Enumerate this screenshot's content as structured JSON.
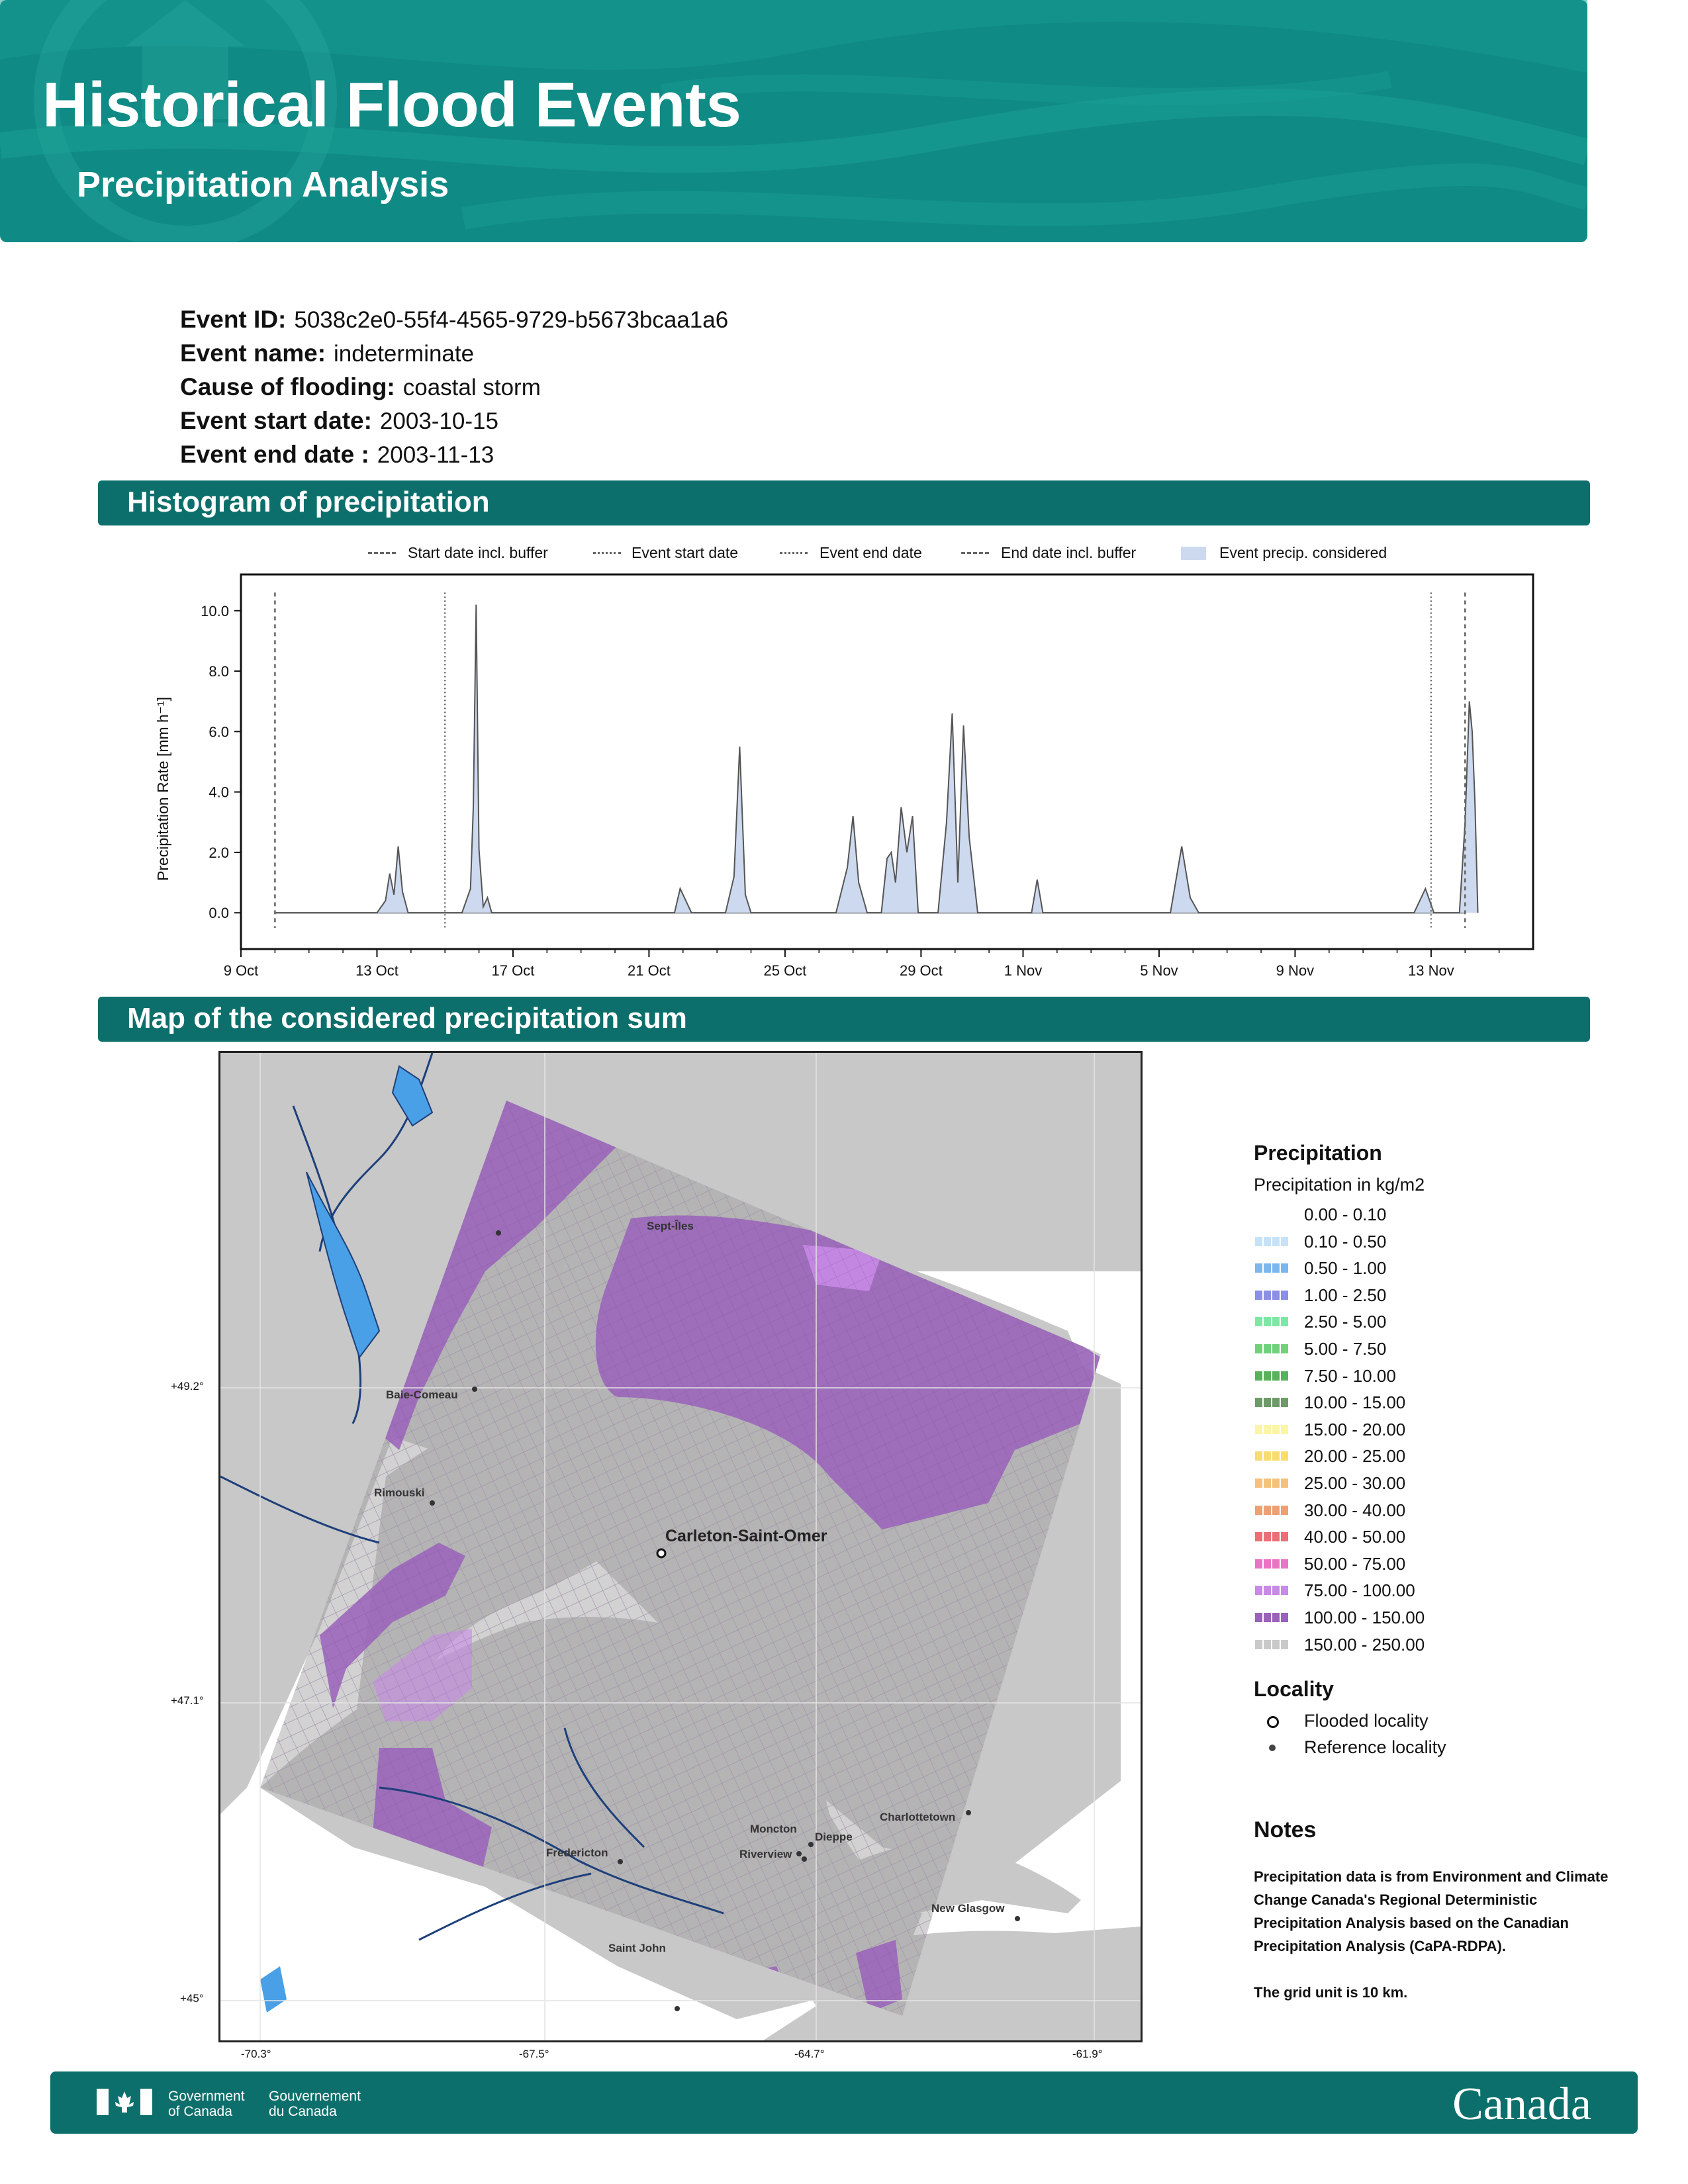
{
  "header": {
    "title": "Historical Flood Events",
    "subtitle": "Precipitation Analysis",
    "background_color": "#108a84"
  },
  "event": {
    "id_label": "Event ID:",
    "id": "5038c2e0-55f4-4565-9729-b5673bcaa1a6",
    "name_label": "Event name:",
    "name": "indeterminate",
    "cause_label": "Cause of flooding:",
    "cause": "coastal storm",
    "start_label": "Event start date:",
    "start": "2003-10-15",
    "end_label": "Event end date :",
    "end": "2003-11-13"
  },
  "sections": {
    "histogram": "Histogram of precipitation",
    "map": "Map of the considered precipitation sum",
    "color": "#0d6f6b"
  },
  "chart_data": {
    "type": "area",
    "title": "",
    "xlabel": "",
    "ylabel": "Precipitation Rate [mm h⁻¹]",
    "x_ticks": [
      "9 Oct",
      "13 Oct",
      "17 Oct",
      "21 Oct",
      "25 Oct",
      "29 Oct",
      "1 Nov",
      "5 Nov",
      "9 Nov",
      "13 Nov"
    ],
    "y_ticks": [
      "0.0",
      "2.0",
      "4.0",
      "6.0",
      "8.0",
      "10.0"
    ],
    "ylim": [
      -1.2,
      11.2
    ],
    "xlim": [
      "2003-10-09",
      "2003-11-16"
    ],
    "legend_position": "top",
    "legend": [
      "Start date incl. buffer",
      "Event start date",
      "Event end date",
      "End date incl. buffer",
      "Event precip. considered"
    ],
    "markers": {
      "start_buffer": "2003-10-10",
      "event_start": "2003-10-15",
      "event_end": "2003-11-13",
      "end_buffer": "2003-11-14"
    },
    "series": [
      {
        "values": [
          [
            "2003-10-10",
            0
          ],
          [
            "2003-10-13",
            0
          ],
          [
            "2003-10-13 06:00",
            0.4
          ],
          [
            "2003-10-13 09:00",
            1.3
          ],
          [
            "2003-10-13 12:00",
            0.6
          ],
          [
            "2003-10-13 15:00",
            2.2
          ],
          [
            "2003-10-13 18:00",
            0.7
          ],
          [
            "2003-10-13 22:00",
            0
          ],
          [
            "2003-10-15 12:00",
            0
          ],
          [
            "2003-10-15 18:00",
            0.8
          ],
          [
            "2003-10-15 20:00",
            3.5
          ],
          [
            "2003-10-15 22:00",
            10.2
          ],
          [
            "2003-10-16 00:00",
            2.1
          ],
          [
            "2003-10-16 03:00",
            0.2
          ],
          [
            "2003-10-16 06:00",
            0.5
          ],
          [
            "2003-10-16 09:00",
            0
          ],
          [
            "2003-10-21 18:00",
            0
          ],
          [
            "2003-10-21 22:00",
            0.8
          ],
          [
            "2003-10-22 02:00",
            0.4
          ],
          [
            "2003-10-22 06:00",
            0
          ],
          [
            "2003-10-23 06:00",
            0
          ],
          [
            "2003-10-23 12:00",
            1.2
          ],
          [
            "2003-10-23 16:00",
            5.5
          ],
          [
            "2003-10-23 20:00",
            0.6
          ],
          [
            "2003-10-24 00:00",
            0
          ],
          [
            "2003-10-26 12:00",
            0
          ],
          [
            "2003-10-26 20:00",
            1.5
          ],
          [
            "2003-10-27 00:00",
            3.2
          ],
          [
            "2003-10-27 04:00",
            1.0
          ],
          [
            "2003-10-27 10:00",
            0
          ],
          [
            "2003-10-27 20:00",
            0
          ],
          [
            "2003-10-28 00:00",
            1.8
          ],
          [
            "2003-10-28 03:00",
            2.0
          ],
          [
            "2003-10-28 06:00",
            1.0
          ],
          [
            "2003-10-28 10:00",
            3.5
          ],
          [
            "2003-10-28 14:00",
            2.0
          ],
          [
            "2003-10-28 18:00",
            3.2
          ],
          [
            "2003-10-28 22:00",
            0
          ],
          [
            "2003-10-29 12:00",
            0
          ],
          [
            "2003-10-29 18:00",
            3.0
          ],
          [
            "2003-10-29 22:00",
            6.6
          ],
          [
            "2003-10-30 02:00",
            1.0
          ],
          [
            "2003-10-30 06:00",
            6.2
          ],
          [
            "2003-10-30 10:00",
            2.5
          ],
          [
            "2003-10-30 16:00",
            0
          ],
          [
            "2003-11-01 06:00",
            0
          ],
          [
            "2003-11-01 10:00",
            1.1
          ],
          [
            "2003-11-01 14:00",
            0
          ],
          [
            "2003-11-05 08:00",
            0
          ],
          [
            "2003-11-05 16:00",
            2.2
          ],
          [
            "2003-11-05 22:00",
            0.5
          ],
          [
            "2003-11-06 04:00",
            0
          ],
          [
            "2003-11-12 12:00",
            0
          ],
          [
            "2003-11-12 20:00",
            0.8
          ],
          [
            "2003-11-13 02:00",
            0
          ],
          [
            "2003-11-13 20:00",
            0
          ],
          [
            "2003-11-14 00:00",
            3.0
          ],
          [
            "2003-11-14 03:00",
            7.0
          ],
          [
            "2003-11-14 05:00",
            6.0
          ],
          [
            "2003-11-14 07:00",
            3.6
          ],
          [
            "2003-11-14 09:00",
            0
          ]
        ]
      }
    ]
  },
  "map": {
    "coords": {
      "lat1": "+49.2°",
      "lat2": "+47.1°",
      "lat3": "+45°",
      "lon1": "-70.3°",
      "lon2": "-67.5°",
      "lon3": "-64.7°",
      "lon4": "-61.9°"
    },
    "flooded_locality": "Carleton-Saint-Omer",
    "reference_localities": [
      "Sept-Îles",
      "Baie-Comeau",
      "Rimouski",
      "Moncton",
      "Dieppe",
      "Riverview",
      "Fredericton",
      "Charlottetown",
      "New Glasgow",
      "Saint John"
    ]
  },
  "map_legend": {
    "title": "Precipitation",
    "subtitle": "Precipitation in kg/m2",
    "classes": [
      {
        "label": "0.00 - 0.10",
        "color": "#ffffff"
      },
      {
        "label": "0.10 - 0.50",
        "color": "#c6e2f7"
      },
      {
        "label": "0.50 - 1.00",
        "color": "#7ab7ee"
      },
      {
        "label": "1.00 - 2.50",
        "color": "#8b8fe6"
      },
      {
        "label": "2.50 - 5.00",
        "color": "#7de8a6"
      },
      {
        "label": "5.00 - 7.50",
        "color": "#6fd27a"
      },
      {
        "label": "7.50 - 10.00",
        "color": "#58b15b"
      },
      {
        "label": "10.00 - 15.00",
        "color": "#6e9a6a"
      },
      {
        "label": "15.00 - 20.00",
        "color": "#fbf5a4"
      },
      {
        "label": "20.00 - 25.00",
        "color": "#f9dc6e"
      },
      {
        "label": "25.00 - 30.00",
        "color": "#f4c27b"
      },
      {
        "label": "30.00 - 40.00",
        "color": "#ee9f73"
      },
      {
        "label": "40.00 - 50.00",
        "color": "#ec6e76"
      },
      {
        "label": "50.00 - 75.00",
        "color": "#ea73c3"
      },
      {
        "label": "75.00 - 100.00",
        "color": "#c78ae6"
      },
      {
        "label": "100.00 - 150.00",
        "color": "#9a62bb"
      },
      {
        "label": "150.00 - 250.00",
        "color": "#c9c9c9"
      }
    ],
    "locality_title": "Locality",
    "flooded_label": "Flooded locality",
    "reference_label": "Reference locality"
  },
  "notes": {
    "title": "Notes",
    "text1": "Precipitation data is from Environment and Climate Change Canada's Regional Deterministic Precipitation Analysis based on the Canadian Precipitation Analysis (CaPA-RDPA).",
    "text2": "The grid unit is 10 km."
  },
  "footer": {
    "gov_en_1": "Government",
    "gov_en_2": "of Canada",
    "gov_fr_1": "Gouvernement",
    "gov_fr_2": "du Canada",
    "wordmark": "Canada"
  }
}
